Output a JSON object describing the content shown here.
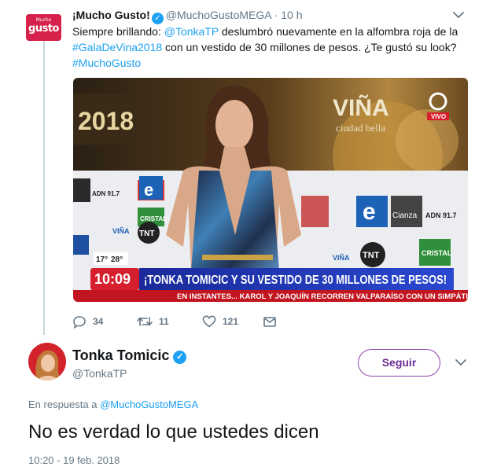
{
  "parent_tweet": {
    "avatar": {
      "line1": "Mucho",
      "line2": "gusto"
    },
    "display_name": "¡Mucho Gusto!",
    "handle": "@MuchoGustoMEGA",
    "separator": "·",
    "time": "10 h",
    "text": {
      "part1": "Siempre brillando: ",
      "mention": "@TonkaTP",
      "part2": " deslumbró nuevamente en la alfombra roja de la ",
      "hashtag1": "#GalaDeVina2018",
      "part3": " con un vestido de 30 millones de pesos. ¿Te gustó su look? ",
      "hashtag2": "#MuchoGusto"
    },
    "media": {
      "backdrop_line1": "VIÑA",
      "backdrop_line2": "ciudad bella",
      "backdrop_year": "2018",
      "channel": "VIVO",
      "clock": "10:09",
      "temp1": "17°",
      "temp2": "28°",
      "headline": "¡TONKA TOMICIC Y SU VESTIDO DE 30 MILLONES DE PESOS!",
      "ticker": "EN INSTANTES... KAROL Y JOAQUÍN RECORREN VALPARAÍSO CON UN SIMPÁTI",
      "logo_tnt": "TNT",
      "logo_adn": "ADN 91.7",
      "logo_cristal": "CRISTAL",
      "logo_vina": "VIÑA",
      "logo_cianza": "Cianza"
    },
    "actions": {
      "replies": "34",
      "retweets": "11",
      "likes": "121"
    }
  },
  "reply_tweet": {
    "display_name": "Tonka Tomicic",
    "handle": "@TonkaTP",
    "follow_label": "Seguir",
    "in_reply_prefix": "En respuesta a ",
    "in_reply_handle": "@MuchoGustoMEGA",
    "text": "No es verdad lo que ustedes dicen",
    "timestamp": "10:20 - 19 feb. 2018"
  },
  "colors": {
    "link": "#1da1f2",
    "follow_border": "#8e44ad",
    "brand": "#d6224b",
    "muted": "#657786"
  }
}
